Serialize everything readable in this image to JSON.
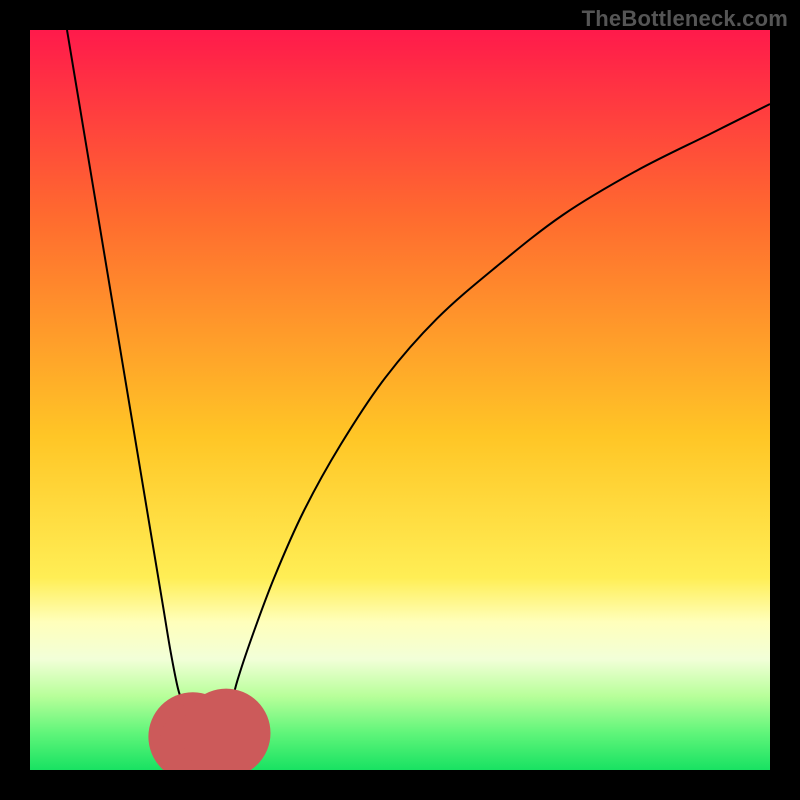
{
  "watermark": "TheBottleneck.com",
  "chart_data": {
    "type": "line",
    "title": "",
    "xlabel": "",
    "ylabel": "",
    "xlim": [
      0,
      100
    ],
    "ylim": [
      0,
      100
    ],
    "grid": false,
    "legend": false,
    "background_gradient": {
      "stops": [
        {
          "offset": 0.0,
          "color": "#ff1a4b"
        },
        {
          "offset": 0.25,
          "color": "#ff6a2f"
        },
        {
          "offset": 0.55,
          "color": "#ffc626"
        },
        {
          "offset": 0.74,
          "color": "#ffee55"
        },
        {
          "offset": 0.8,
          "color": "#ffffbb"
        },
        {
          "offset": 0.85,
          "color": "#f2ffd8"
        },
        {
          "offset": 0.9,
          "color": "#b8ff9a"
        },
        {
          "offset": 0.95,
          "color": "#60f57a"
        },
        {
          "offset": 1.0,
          "color": "#18e262"
        }
      ]
    },
    "series": [
      {
        "name": "curve",
        "color": "#000000",
        "x": [
          5,
          6,
          7,
          8,
          9,
          10,
          11,
          12,
          13,
          14,
          15,
          16,
          17,
          18,
          19,
          20,
          21,
          22,
          23,
          24,
          25,
          26,
          27,
          28,
          30,
          33,
          37,
          42,
          48,
          55,
          63,
          72,
          82,
          92,
          100
        ],
        "y": [
          100,
          94,
          88,
          82,
          76,
          70,
          64,
          58,
          52,
          46,
          40,
          34,
          28,
          22,
          16,
          11,
          8,
          5,
          3.5,
          3,
          3.5,
          5,
          8,
          12,
          18,
          26,
          35,
          44,
          53,
          61,
          68,
          75,
          81,
          86,
          90
        ]
      }
    ],
    "markers": [
      {
        "name": "valley-left",
        "x": 22.0,
        "y": 4.5,
        "r": 2.0,
        "color": "#cc5a5a"
      },
      {
        "name": "valley-bottom",
        "x": 24.0,
        "y": 3.0,
        "r": 2.2,
        "color": "#cc5a5a"
      },
      {
        "name": "valley-right",
        "x": 26.5,
        "y": 5.0,
        "r": 2.0,
        "color": "#cc5a5a"
      }
    ]
  }
}
